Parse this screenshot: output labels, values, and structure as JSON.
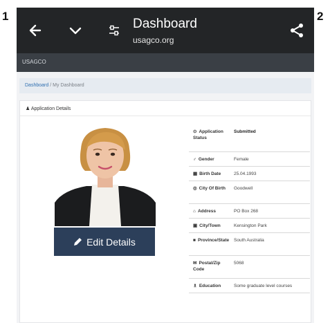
{
  "markers": {
    "left": "1",
    "right": "2"
  },
  "appbar": {
    "title": "Dashboard",
    "url": "usagco.org",
    "icons": {
      "back": "arrow-left-icon",
      "expand": "chevron-down-icon",
      "settings": "tune-icon",
      "share": "share-icon"
    }
  },
  "subbar": {
    "text": "USAGCO"
  },
  "breadcrumb": {
    "root": "Dashboard",
    "separator": "/",
    "current": "My Dashboard"
  },
  "card": {
    "title": "Application Details",
    "edit_button": "Edit Details",
    "edit_icon": "pencil-icon"
  },
  "details": [
    {
      "icon": "⊙",
      "label": "Application Status",
      "value": "Submitted"
    },
    {
      "icon": "♂",
      "label": "Gender",
      "value": "Female"
    },
    {
      "icon": "▦",
      "label": "Birth Date",
      "value": "25.04.1993"
    },
    {
      "icon": "◎",
      "label": "City Of Birth",
      "value": "Goodwell"
    },
    {
      "icon": "⌂",
      "label": "Address",
      "value": "PO Box 268"
    },
    {
      "icon": "▣",
      "label": "City/Town",
      "value": "Kensington Park"
    },
    {
      "icon": "■",
      "label": "Province/State",
      "value": "South Australia"
    },
    {
      "icon": "✉",
      "label": "Postal/Zip Code",
      "value": "5068"
    },
    {
      "icon": "♗",
      "label": "Education",
      "value": "Some graduate level courses"
    }
  ],
  "colors": {
    "appbar": "#232527",
    "subbar": "#3a3f45",
    "button": "#2c3f5a",
    "link": "#2f6fb0"
  }
}
